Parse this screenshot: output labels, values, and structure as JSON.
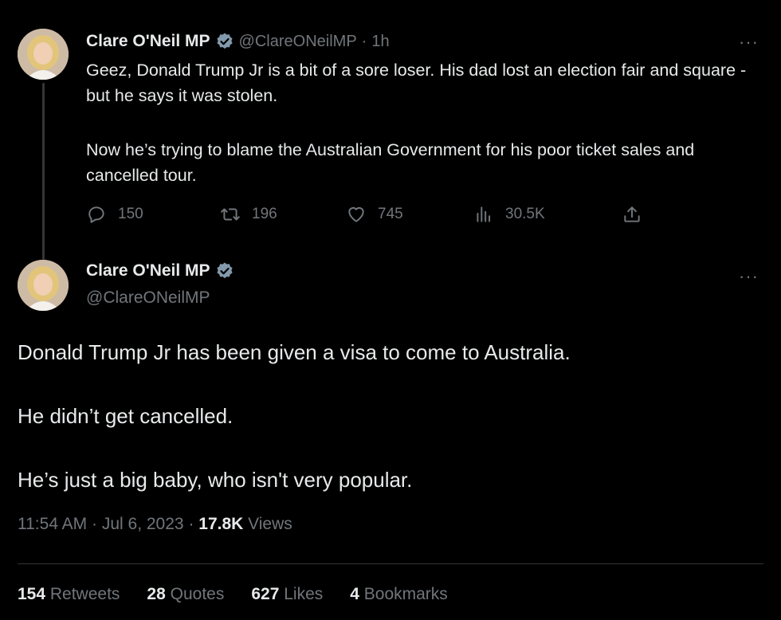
{
  "author": {
    "display_name": "Clare O'Neil MP",
    "handle": "@ClareONeilMP"
  },
  "tweet1": {
    "time_ago": "1h",
    "separator": "·",
    "more": "···",
    "paragraphs": [
      "Geez, Donald Trump Jr is a bit of a sore loser. His dad lost an election fair and square - but he says it was stolen.",
      "Now he’s trying to blame the Australian Government for his poor ticket sales and cancelled tour."
    ],
    "actions": {
      "replies": "150",
      "retweets": "196",
      "likes": "745",
      "views": "30.5K"
    }
  },
  "tweet2": {
    "more": "···",
    "paragraphs": [
      "Donald Trump Jr has been given a visa to come to Australia.",
      "He didn’t get cancelled.",
      "He’s just a big baby, who isn't very popular."
    ],
    "meta": {
      "time": "11:54 AM",
      "date": "Jul 6, 2023",
      "sep": "·",
      "views_count": "17.8K",
      "views_label": "Views"
    },
    "stats": [
      {
        "count": "154",
        "label": "Retweets"
      },
      {
        "count": "28",
        "label": "Quotes"
      },
      {
        "count": "627",
        "label": "Likes"
      },
      {
        "count": "4",
        "label": "Bookmarks"
      }
    ]
  },
  "colors": {
    "background": "#000000",
    "text": "#e7e9ea",
    "muted": "#71767b",
    "verified": "#829aab"
  },
  "icons": [
    "verified-badge-icon",
    "reply-icon",
    "retweet-icon",
    "like-icon",
    "views-icon",
    "share-icon",
    "more-icon"
  ]
}
